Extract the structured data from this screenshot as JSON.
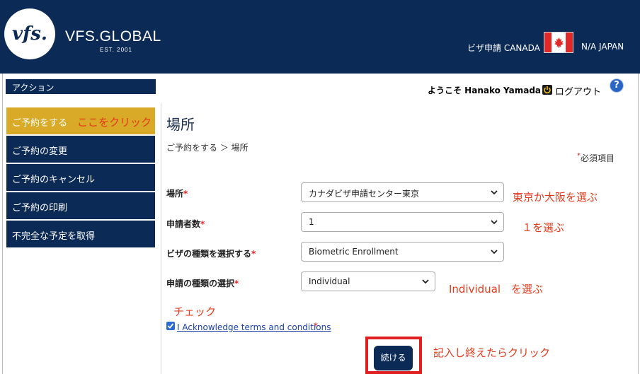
{
  "header": {
    "logo_mark": "vfs.",
    "logo_name": "VFS.GLOBAL",
    "logo_est": "EST. 2001",
    "visa_label": "ビザ申請 CANADA",
    "flag_icon": "canada-flag-icon",
    "country_label": "N/A JAPAN"
  },
  "sidebar": {
    "heading": "アクション",
    "items": [
      {
        "label": "ご予約をする",
        "active": true
      },
      {
        "label": "ご予約の変更",
        "active": false
      },
      {
        "label": "ご予約のキャンセル",
        "active": false
      },
      {
        "label": "ご予約の印刷",
        "active": false
      },
      {
        "label": "不完全な予定を取得",
        "active": false
      }
    ],
    "annotation": "ここをクリック"
  },
  "topbar": {
    "welcome": "ようこそ Hanako Yamada !",
    "logout": "ログアウト",
    "help": "?"
  },
  "main": {
    "title": "場所",
    "breadcrumb": "ご予約をする ＞ 場所",
    "required_mark": "*",
    "required_note": "必須項目",
    "fields": [
      {
        "label": "場所",
        "value": "カナダビザ申請センター東京",
        "annotation": "東京か大阪を選ぶ"
      },
      {
        "label": "申請者数",
        "value": "1",
        "annotation": "１を選ぶ"
      },
      {
        "label": "ビザの種類を選択する",
        "value": "Biometric Enrollment",
        "annotation": ""
      },
      {
        "label": "申請の種類の選択",
        "value": "Individual",
        "annotation": "Individual　を選ぶ"
      }
    ],
    "check_annotation": "チェック",
    "terms": {
      "label": "I Acknowledge terms and conditions ",
      "checked": true
    },
    "submit": {
      "label": "続ける",
      "annotation": "記入し終えたらクリック"
    }
  },
  "colors": {
    "navy": "#0b2a55",
    "active_gold": "#d8aa28",
    "annotation_red": "#e33a1c",
    "highlight_red": "#e02020"
  }
}
